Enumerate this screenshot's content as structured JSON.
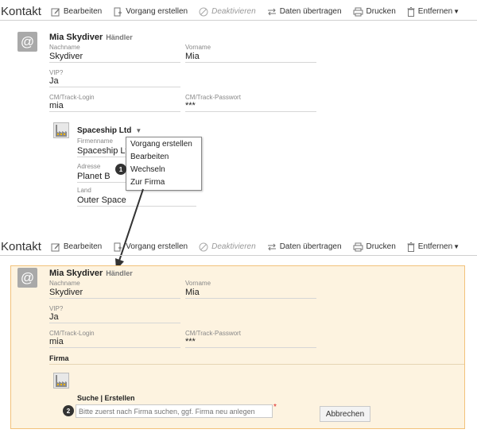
{
  "toolbar": {
    "title": "Kontakt",
    "edit": "Bearbeiten",
    "create_process": "Vorgang erstellen",
    "deactivate": "Deaktivieren",
    "transfer": "Daten übertragen",
    "print": "Drucken",
    "remove": "Entfernen"
  },
  "contact": {
    "avatar_symbol": "@",
    "name": "Mia Skydiver",
    "role": "Händler",
    "lastname_label": "Nachname",
    "lastname": "Skydiver",
    "firstname_label": "Vorname",
    "firstname": "Mia",
    "vip_label": "VIP?",
    "vip": "Ja",
    "login_label": "CM/Track-Login",
    "login": "mia",
    "password_label": "CM/Track-Passwort",
    "password": "***"
  },
  "company": {
    "name": "Spaceship Ltd",
    "firmname_label": "Firmenname",
    "firmname": "Spaceship Ltd",
    "address_label": "Adresse",
    "address": "Planet B",
    "country_label": "Land",
    "country": "Outer Space"
  },
  "context_menu": {
    "items": [
      "Vorgang erstellen",
      "Bearbeiten",
      "Wechseln",
      "Zur Firma"
    ]
  },
  "edit_section": {
    "firma_title": "Firma",
    "search_label": "Suche | Erstellen",
    "search_placeholder": "Bitte zuerst nach Firma suchen, ggf. Firma neu anlegen",
    "required_mark": "*",
    "cancel": "Abbrechen"
  },
  "callouts": {
    "one": "1",
    "two": "2"
  },
  "colors": {
    "panel_bg": "#fdf3e0",
    "panel_border": "#f2c27b",
    "badge": "#333333"
  }
}
